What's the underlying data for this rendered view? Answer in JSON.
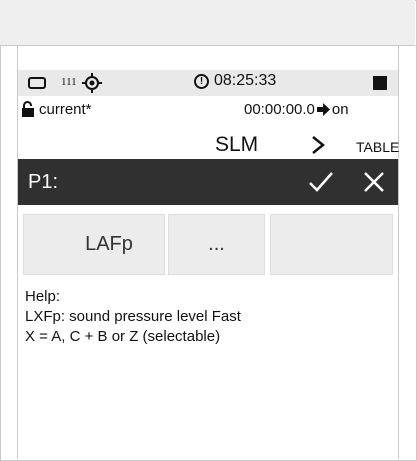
{
  "status_bar": {
    "signal_count": "111",
    "clock": "08:25:33",
    "alert_symbol": "!"
  },
  "file": {
    "name": "current*",
    "elapsed": "00:00:00.0",
    "state": "on"
  },
  "view": {
    "mode": "SLM",
    "next": "TABLE"
  },
  "param_bar": {
    "title": "P1:"
  },
  "options": [
    {
      "label": "LAFp"
    },
    {
      "label": "..."
    },
    {
      "label": ""
    }
  ],
  "help": {
    "heading": "Help:",
    "line1": "LXFp: sound pressure level Fast",
    "line2": "X = A, C + B or Z (selectable)"
  },
  "icons": {
    "battery": "battery-outline-icon",
    "gps": "gps-icon",
    "alert": "alert-icon",
    "stop": "stop-square-icon",
    "lock": "lock-open-icon",
    "arrow": "arrow-right-icon",
    "next": "chevron-right-icon",
    "confirm": "checkmark-icon",
    "cancel": "close-icon"
  },
  "colors": {
    "param_bar": "#303030",
    "status_bar": "#e9e9e9",
    "tile": "#ececec"
  }
}
